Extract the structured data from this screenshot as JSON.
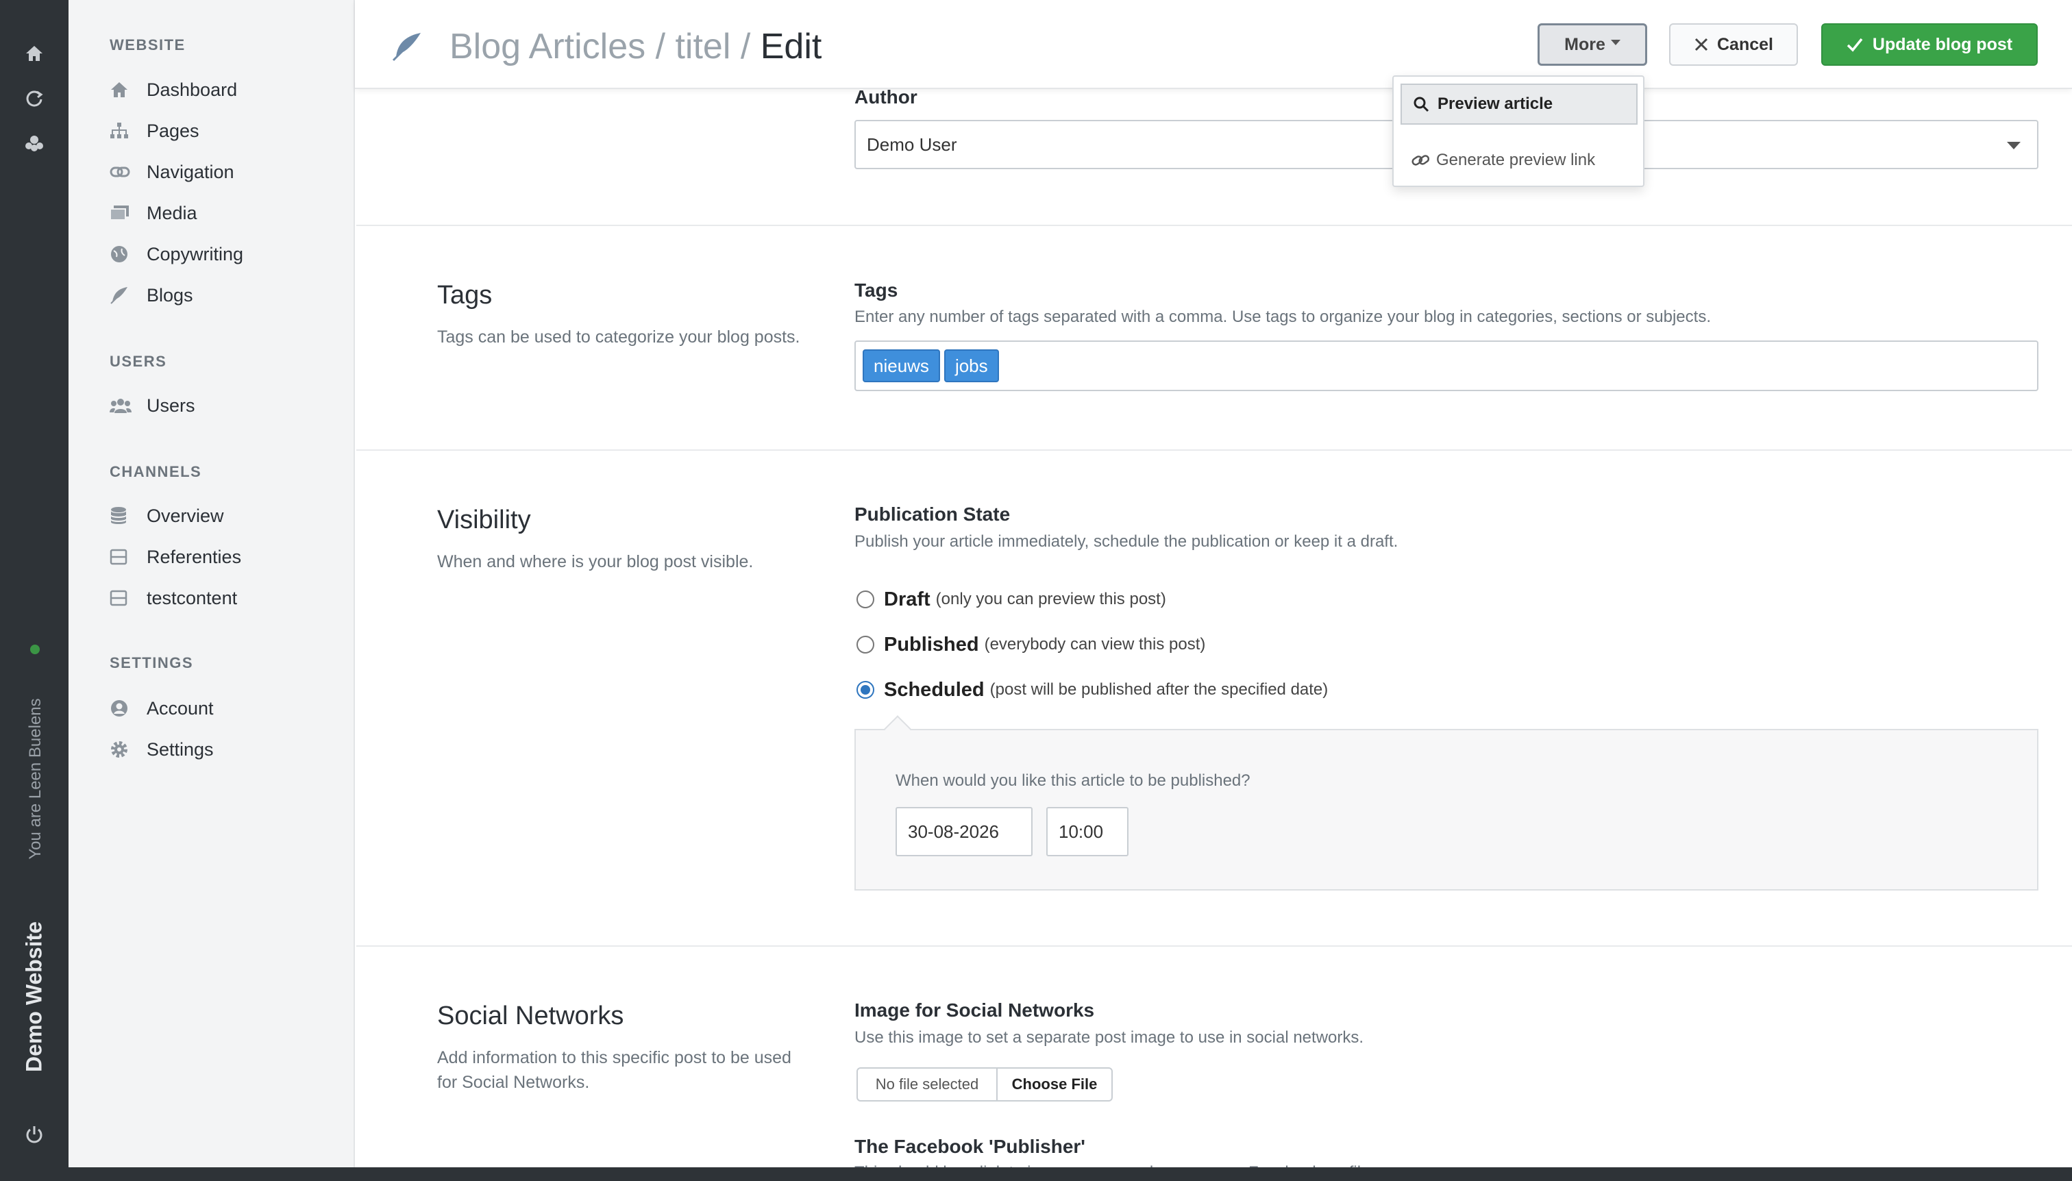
{
  "rail": {
    "user_text": "You are Leen Buelens",
    "site_name": "Demo Website",
    "icons": [
      "home-icon",
      "refresh-icon",
      "users-icon",
      "power-icon"
    ]
  },
  "sidebar": {
    "sections": [
      {
        "heading": "WEBSITE",
        "items": [
          {
            "label": "Dashboard",
            "icon": "home-icon"
          },
          {
            "label": "Pages",
            "icon": "sitemap-icon"
          },
          {
            "label": "Navigation",
            "icon": "link-icon"
          },
          {
            "label": "Media",
            "icon": "images-icon"
          },
          {
            "label": "Copywriting",
            "icon": "globe-icon"
          },
          {
            "label": "Blogs",
            "icon": "feather-icon"
          }
        ]
      },
      {
        "heading": "USERS",
        "items": [
          {
            "label": "Users",
            "icon": "users-icon"
          }
        ]
      },
      {
        "heading": "CHANNELS",
        "items": [
          {
            "label": "Overview",
            "icon": "database-icon"
          },
          {
            "label": "Referenties",
            "icon": "box-icon"
          },
          {
            "label": "testcontent",
            "icon": "box-icon"
          }
        ]
      },
      {
        "heading": "SETTINGS",
        "items": [
          {
            "label": "Account",
            "icon": "user-circle-icon"
          },
          {
            "label": "Settings",
            "icon": "gear-icon"
          }
        ]
      }
    ]
  },
  "header": {
    "crumb_1": "Blog Articles",
    "crumb_sep": " / ",
    "crumb_2": "titel",
    "crumb_3": "Edit",
    "more_label": "More",
    "cancel_label": "Cancel",
    "update_label": "Update blog post"
  },
  "more_menu": {
    "items": [
      "Preview article",
      "Generate preview link"
    ]
  },
  "author": {
    "label": "Author",
    "value": "Demo User"
  },
  "tags_section": {
    "title": "Tags",
    "description": "Tags can be used to categorize your blog posts.",
    "field_label": "Tags",
    "help": "Enter any number of tags separated with a comma. Use tags to organize your blog in categories, sections or subjects.",
    "tags": [
      "nieuws",
      "jobs"
    ]
  },
  "visibility": {
    "title": "Visibility",
    "description": "When and where is your blog post visible.",
    "field_label": "Publication State",
    "help": "Publish your article immediately, schedule the publication or keep it a draft.",
    "options": [
      {
        "title": "Draft",
        "note": "(only you can preview this post)",
        "selected": false
      },
      {
        "title": "Published",
        "note": "(everybody can view this post)",
        "selected": false
      },
      {
        "title": "Scheduled",
        "note": "(post will be published after the specified date)",
        "selected": true
      }
    ],
    "schedule_question": "When would you like this article to be published?",
    "date": "30-08-2026",
    "time": "10:00"
  },
  "social": {
    "title": "Social Networks",
    "description": "Add information to this specific post to be used for Social Networks.",
    "image_label": "Image for Social Networks",
    "image_help": "Use this image to set a separate post image to use in social networks.",
    "no_file": "No file selected",
    "choose_file": "Choose File",
    "facebook_label": "The Facebook 'Publisher'",
    "facebook_help": "This should be a link to i.e. your personal or company Facebook profile."
  },
  "colors": {
    "primary_green": "#3aa348",
    "tag_blue": "#3f8fdc",
    "rail_dark": "#2e3337"
  }
}
